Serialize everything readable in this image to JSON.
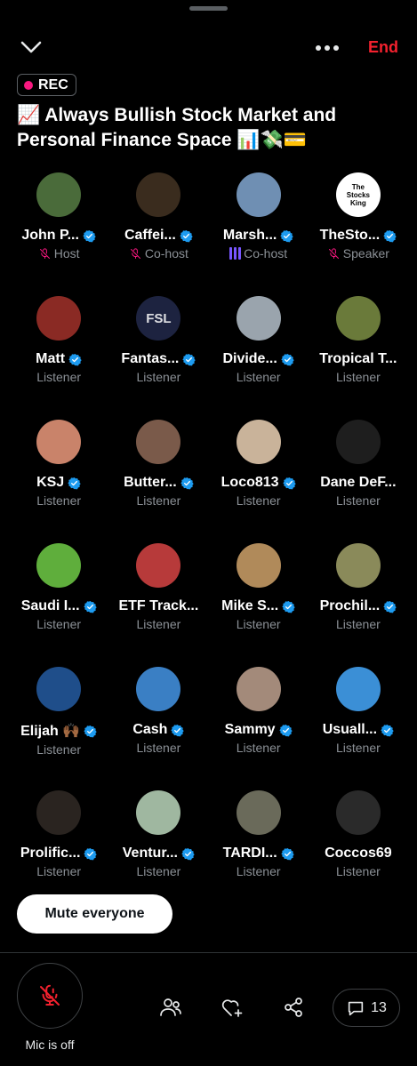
{
  "header": {
    "end_label": "End",
    "rec_label": "REC",
    "title": "📈 Always Bullish Stock Market and Personal Finance Space 📊💸💳"
  },
  "participants": [
    {
      "name": "John P...",
      "role": "Host",
      "verified": true,
      "status": "muted",
      "color": "#4a6b3a"
    },
    {
      "name": "Caffei...",
      "role": "Co-host",
      "verified": true,
      "status": "muted",
      "color": "#3a2c1e"
    },
    {
      "name": "Marsh...",
      "role": "Co-host",
      "verified": true,
      "status": "speaking",
      "color": "#6f8fb3"
    },
    {
      "name": "TheSto...",
      "role": "Speaker",
      "verified": true,
      "status": "muted",
      "color": "#ffffff",
      "logo_text": "The Stocks King"
    },
    {
      "name": "Matt",
      "role": "Listener",
      "verified": true,
      "color": "#8a2a24"
    },
    {
      "name": "Fantas...",
      "role": "Listener",
      "verified": true,
      "color": "#1d2340",
      "logo_text": "FSL"
    },
    {
      "name": "Divide...",
      "role": "Listener",
      "verified": true,
      "color": "#9aa4ad"
    },
    {
      "name": "Tropical T...",
      "role": "Listener",
      "verified": false,
      "color": "#6a7a3a"
    },
    {
      "name": "KSJ",
      "role": "Listener",
      "verified": true,
      "color": "#c9836a"
    },
    {
      "name": "Butter...",
      "role": "Listener",
      "verified": true,
      "color": "#7a5a4a"
    },
    {
      "name": "Loco813",
      "role": "Listener",
      "verified": true,
      "color": "#c9b39a"
    },
    {
      "name": "Dane DeF...",
      "role": "Listener",
      "verified": false,
      "color": "#1e1e1e"
    },
    {
      "name": "Saudi I...",
      "role": "Listener",
      "verified": true,
      "color": "#5fae3c"
    },
    {
      "name": "ETF Track...",
      "role": "Listener",
      "verified": false,
      "color": "#b73a3a"
    },
    {
      "name": "Mike S...",
      "role": "Listener",
      "verified": true,
      "color": "#b08a5a"
    },
    {
      "name": "Prochil...",
      "role": "Listener",
      "verified": true,
      "color": "#8a8a5a"
    },
    {
      "name": "Elijah 🙌🏾",
      "role": "Listener",
      "verified": true,
      "color": "#1f4e8a"
    },
    {
      "name": "Cash",
      "role": "Listener",
      "verified": true,
      "color": "#3a7fc4"
    },
    {
      "name": "Sammy",
      "role": "Listener",
      "verified": true,
      "color": "#a38a7a"
    },
    {
      "name": "Usuall...",
      "role": "Listener",
      "verified": true,
      "color": "#3b8fd6"
    },
    {
      "name": "Prolific...",
      "role": "Listener",
      "verified": true,
      "color": "#2a2420"
    },
    {
      "name": "Ventur...",
      "role": "Listener",
      "verified": true,
      "color": "#9fb7a0"
    },
    {
      "name": "TARDI...",
      "role": "Listener",
      "verified": true,
      "color": "#6a6a5a"
    },
    {
      "name": "Coccos69",
      "role": "Listener",
      "verified": false,
      "color": "#2a2a2a"
    }
  ],
  "controls": {
    "mute_everyone_label": "Mute everyone",
    "mic_label": "Mic is off",
    "comment_count": "13"
  },
  "colors": {
    "accent_red": "#f4212e",
    "rec_dot": "#f91880",
    "verified_blue": "#1d9bf0",
    "speaking_purple": "#7856ff",
    "muted_pink": "#f91880"
  },
  "icons": {
    "collapse": "chevron-down-icon",
    "more": "more-horizontal-icon",
    "mic": "mic-off-icon",
    "people": "people-icon",
    "react": "heart-plus-icon",
    "share": "share-icon",
    "comment": "comment-icon"
  }
}
